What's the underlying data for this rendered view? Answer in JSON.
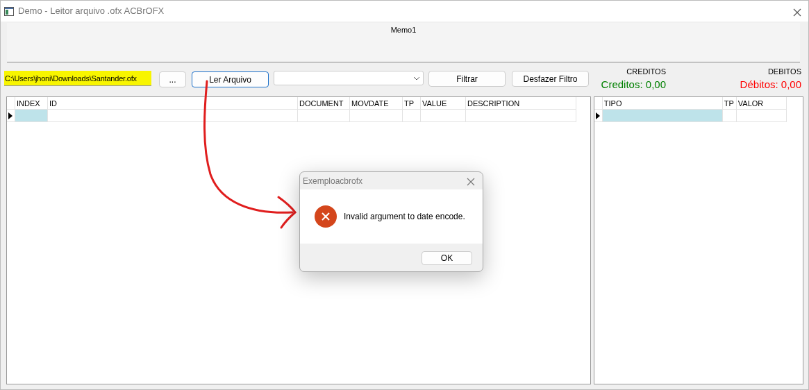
{
  "window": {
    "title": "Demo - Leitor arquivo .ofx ACBrOFX"
  },
  "memo": {
    "text": "Memo1"
  },
  "toolbar": {
    "file_path": "C:\\Users\\jhoni\\Downloads\\Santander.ofx",
    "browse_button": "...",
    "read_button": "Ler Arquivo",
    "filter_button": "Filtrar",
    "undo_filter_button": "Desfazer Filtro"
  },
  "totals": [
    {
      "heading": "CREDITOS",
      "value": "Creditos: 0,00",
      "color": "#008000"
    },
    {
      "heading": "DEBITOS",
      "value": "Débitos: 0,00",
      "color": "#ff0000"
    }
  ],
  "transactions_grid": {
    "columns": [
      "INDEX",
      "ID",
      "DOCUMENT",
      "MOVDATE",
      "TP",
      "VALUE",
      "DESCRIPTION"
    ],
    "rows": [
      {
        "selected": true
      }
    ]
  },
  "summary_grid": {
    "columns": [
      "TIPO",
      "TP",
      "VALOR"
    ],
    "rows": [
      {
        "selected": true
      }
    ]
  },
  "dialog": {
    "title": "Exemploacbrofx",
    "message": "Invalid argument to date encode.",
    "buttons": [
      "OK"
    ]
  }
}
